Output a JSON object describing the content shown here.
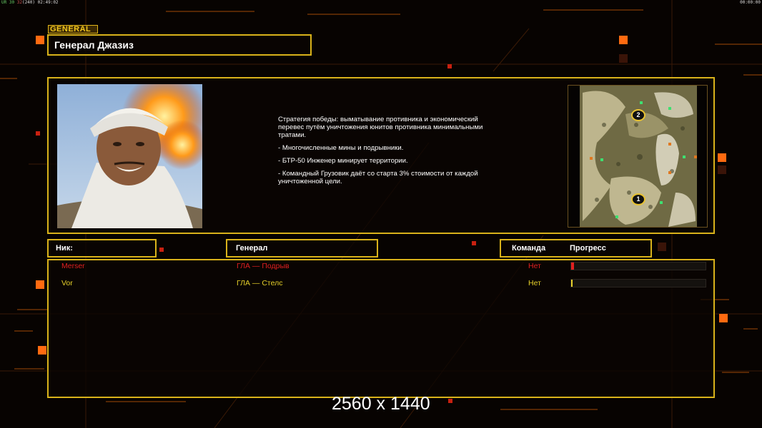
{
  "hud": {
    "left_prefix": "UR",
    "left_fps": "30",
    "left_mid": "32",
    "left_paren": "(240)",
    "left_time": "02:49:02",
    "right_time": "00:00:00"
  },
  "general_tag": "GENERAL",
  "general_name": "Генерал Джазиз",
  "description": [
    "Стратегия победы: выматывание противника и экономический\n перевес путём уничтожения юнитов противника минимальными\n тратами.",
    "- Многочисленные мины и подрывники.",
    "- БТР-50 Инженер минирует территории.",
    "- Командный Грузовик даёт со старта 3% стоимости от каждой\n уничтоженной цели."
  ],
  "map": {
    "markers": [
      "2",
      "1"
    ]
  },
  "headers": {
    "nick": "Ник:",
    "general": "Генерал",
    "team": "Команда",
    "progress": "Прогресс"
  },
  "players": [
    {
      "nick": "Merser",
      "general": "ГЛА — Подрыв",
      "team": "Нет",
      "progress": 0.02,
      "color": "#e02020"
    },
    {
      "nick": "Vor",
      "general": "ГЛА — Стелс",
      "team": "Нет",
      "progress": 0.01,
      "color": "#e6d02a"
    }
  ],
  "resolution": "2560 x 1440",
  "colors": {
    "frame": "#d9b21a",
    "accent_orange": "#ff6a10",
    "background": "#070301"
  }
}
